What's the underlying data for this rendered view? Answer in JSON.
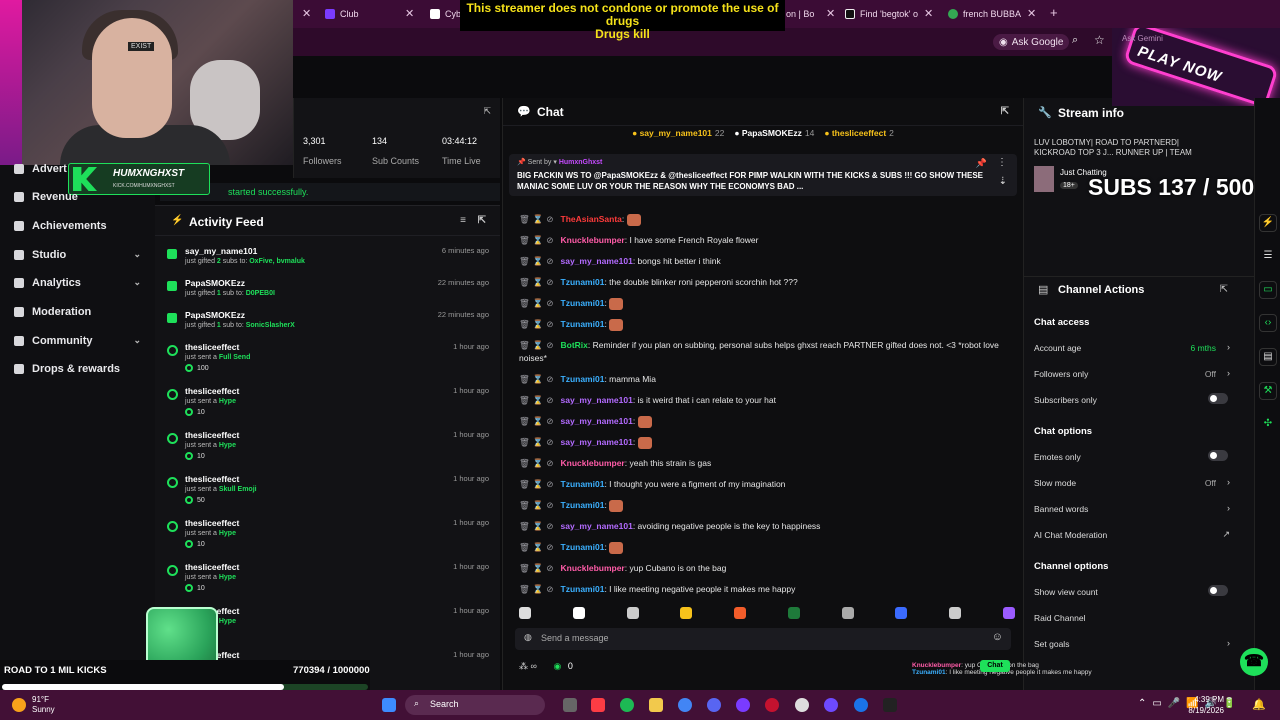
{
  "browser": {
    "tabs": [
      {
        "label": "Club",
        "color": "#7a3bff"
      },
      {
        "label": "Cyb",
        "color": "#222222"
      },
      {
        "label": "on | Bo",
        "color": "#5a3b7a"
      },
      {
        "label": "Find 'begtok' o",
        "color": "#000000"
      },
      {
        "label": "french BUBBA -",
        "color": "#34a853"
      }
    ],
    "ask_google": "Ask Google",
    "ask_gemini": "Ask Gemini"
  },
  "warning": {
    "line1": "This streamer does not condone or promote the use of drugs",
    "line2": "Drugs kill"
  },
  "overlay": {
    "brand_title": "HUMXNGHXST",
    "brand_sub": "KICK.COM/HUMXNGHXST",
    "play_now": "PLAY NOW",
    "cap_text": "EXIST",
    "subs_goal": "SUBS 137 / 500",
    "road_label": "ROAD TO 1 MIL KICKS",
    "road_value": "770394 / 1000000",
    "road_progress": 0.770394
  },
  "sidebar": {
    "items": [
      {
        "label": "Advert",
        "chev": false
      },
      {
        "label": "Revenue",
        "chev": false
      },
      {
        "label": "Achievements",
        "chev": false
      },
      {
        "label": "Studio",
        "chev": true
      },
      {
        "label": "Analytics",
        "chev": true
      },
      {
        "label": "Moderation",
        "chev": false
      },
      {
        "label": "Community",
        "chev": true
      },
      {
        "label": "Drops & rewards",
        "chev": false
      }
    ]
  },
  "stats": {
    "followers_value": "3,301",
    "followers_label": "Followers",
    "subs_value": "134",
    "subs_label": "Sub Counts",
    "time_value": "03:44:12",
    "time_label": "Time Live",
    "started_msg": "started successfully."
  },
  "activity": {
    "title": "Activity Feed",
    "items": [
      {
        "name": "say_my_name101",
        "pre": "just gifted ",
        "highlight": "2",
        "post": " subs to: ",
        "target": "OxFive, bvmaluk",
        "amount": "",
        "time": "6 minutes ago",
        "type": "gift"
      },
      {
        "name": "PapaSMOKEzz",
        "pre": "just gifted ",
        "highlight": "1",
        "post": " sub to: ",
        "target": "D0PEB0I",
        "amount": "",
        "time": "22 minutes ago",
        "type": "gift"
      },
      {
        "name": "PapaSMOKEzz",
        "pre": "just gifted ",
        "highlight": "1",
        "post": " sub to: ",
        "target": "SonicSlasherX",
        "amount": "",
        "time": "22 minutes ago",
        "type": "gift"
      },
      {
        "name": "thesliceeffect",
        "pre": "just sent a ",
        "highlight": "Full Send",
        "post": "",
        "target": "",
        "amount": "100",
        "time": "1 hour ago",
        "type": "kick"
      },
      {
        "name": "thesliceeffect",
        "pre": "just sent a ",
        "highlight": "Hype",
        "post": "",
        "target": "",
        "amount": "10",
        "time": "1 hour ago",
        "type": "kick"
      },
      {
        "name": "thesliceeffect",
        "pre": "just sent a ",
        "highlight": "Hype",
        "post": "",
        "target": "",
        "amount": "10",
        "time": "1 hour ago",
        "type": "kick"
      },
      {
        "name": "thesliceeffect",
        "pre": "just sent a ",
        "highlight": "Skull Emoji",
        "post": "",
        "target": "",
        "amount": "50",
        "time": "1 hour ago",
        "type": "kick"
      },
      {
        "name": "thesliceeffect",
        "pre": "just sent a ",
        "highlight": "Hype",
        "post": "",
        "target": "",
        "amount": "10",
        "time": "1 hour ago",
        "type": "kick"
      },
      {
        "name": "thesliceeffect",
        "pre": "just sent a ",
        "highlight": "Hype",
        "post": "",
        "target": "",
        "amount": "10",
        "time": "1 hour ago",
        "type": "kick"
      },
      {
        "name": "thesliceeffect",
        "pre": "just sent a ",
        "highlight": "Hype",
        "post": "",
        "target": "",
        "amount": "",
        "time": "1 hour ago",
        "type": "kick"
      },
      {
        "name": "thesliceeffect",
        "pre": "just sent a ",
        "highlight": "Hype",
        "post": "",
        "target": "",
        "amount": "",
        "time": "1 hour ago",
        "type": "kick"
      }
    ]
  },
  "chat": {
    "title": "Chat",
    "gifters": [
      {
        "name": "say_my_name101",
        "count": "22",
        "color": "#f7c21b"
      },
      {
        "name": "PapaSMOKEzz",
        "count": "14",
        "color": "#ffffff"
      },
      {
        "name": "thesliceeffect",
        "count": "2",
        "color": "#f7c21b"
      }
    ],
    "pinned_by_label": "Sent by",
    "pinned_by": "HumxnGhxst",
    "pinned_msg": "BIG FACKIN WS TO @PapaSMOKEzz & @thesliceeffect FOR PIMP WALKIN WITH THE KICKS & SUBS !!! GO SHOW THESE MANIAC SOME LUV OR YOUR THE REASON WHY THE ECONOMYS BAD ...",
    "messages": [
      {
        "user": "TheAsianSanta",
        "color": "#ff3b3b",
        "text": ""
      },
      {
        "user": "Knucklebumper",
        "color": "#ff5ca8",
        "text": "I have some French Royale flower"
      },
      {
        "user": "say_my_name101",
        "color": "#b36bff",
        "text": "bongs hit better i think"
      },
      {
        "user": "Tzunami01",
        "color": "#3bb0ff",
        "text": "the double blinker roni pepperoni scorchin hot ???"
      },
      {
        "user": "Tzunami01",
        "color": "#3bb0ff",
        "text": ""
      },
      {
        "user": "Tzunami01",
        "color": "#3bb0ff",
        "text": ""
      },
      {
        "user": "BotRix",
        "color": "#1ee05a",
        "text": "Reminder if you plan on subbing, personal subs helps ghxst reach PARTNER gifted does not. <3 *robot love noises*"
      },
      {
        "user": "Tzunami01",
        "color": "#3bb0ff",
        "text": "mamma Mia"
      },
      {
        "user": "say_my_name101",
        "color": "#b36bff",
        "text": "is it weird that i can relate to your hat"
      },
      {
        "user": "say_my_name101",
        "color": "#b36bff",
        "text": ""
      },
      {
        "user": "say_my_name101",
        "color": "#b36bff",
        "text": ""
      },
      {
        "user": "Knucklebumper",
        "color": "#ff5ca8",
        "text": "yeah this strain is gas"
      },
      {
        "user": "Tzunami01",
        "color": "#3bb0ff",
        "text": "I thought you were a figment of my imagination"
      },
      {
        "user": "Tzunami01",
        "color": "#3bb0ff",
        "text": ""
      },
      {
        "user": "say_my_name101",
        "color": "#b36bff",
        "text": "avoiding negative people is the key to happiness"
      },
      {
        "user": "Tzunami01",
        "color": "#3bb0ff",
        "text": ""
      },
      {
        "user": "Knucklebumper",
        "color": "#ff5ca8",
        "text": "yup Cubano is on the bag"
      },
      {
        "user": "Tzunami01",
        "color": "#3bb0ff",
        "text": "I like meeting negative people it makes me happy"
      }
    ],
    "input_placeholder": "Send a message",
    "viewer_count": "0",
    "send_label": "Chat"
  },
  "minichat": [
    {
      "user": "Knucklebumper",
      "text": "yup Cubano is on the bag"
    },
    {
      "user": "Tzunami01",
      "text": "I like meeting negative people it makes me happy"
    }
  ],
  "stream_info": {
    "title": "Stream info",
    "desc": "LUV LOBOTMY| ROAD TO PARTNERD| KICKROAD TOP 3 J... RUNNER UP | TEAM",
    "category": "Just Chatting",
    "age": "18+"
  },
  "channel_actions": {
    "title": "Channel Actions",
    "chat_access": "Chat access",
    "account_age_label": "Account age",
    "account_age_value": "6 mths",
    "followers_only_label": "Followers only",
    "followers_only_value": "Off",
    "subscribers_only_label": "Subscribers only",
    "chat_options": "Chat options",
    "emotes_only_label": "Emotes only",
    "slow_mode_label": "Slow mode",
    "slow_mode_value": "Off",
    "banned_words_label": "Banned words",
    "ai_mod_label": "AI Chat Moderation",
    "channel_options": "Channel options",
    "show_view_count_label": "Show view count",
    "raid_label": "Raid Channel",
    "set_goals_label": "Set goals"
  },
  "taskbar": {
    "temp": "91°F",
    "weather": "Sunny",
    "search": "Search",
    "time": "4:39 PM",
    "date": "8/19/2026"
  }
}
